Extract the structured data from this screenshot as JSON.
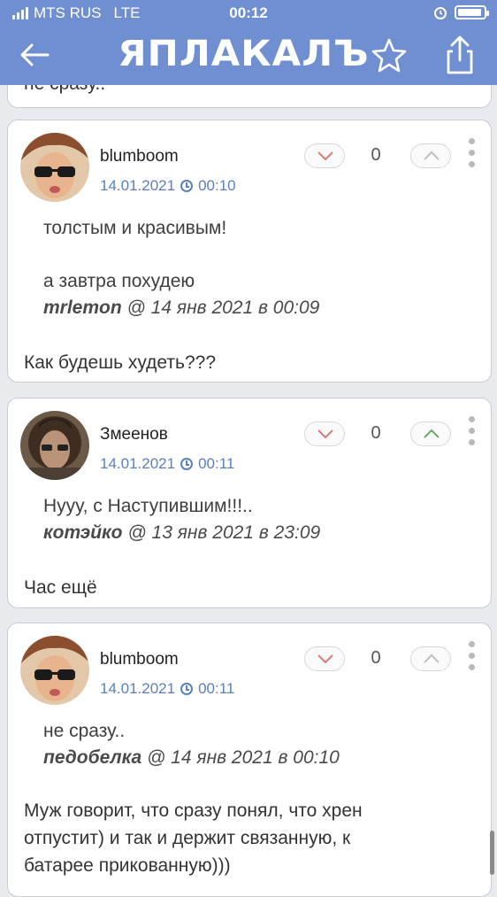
{
  "status_bar": {
    "carrier": "MTS RUS",
    "network": "LTE",
    "time": "00:12"
  },
  "header": {
    "logo_text": "ЯПЛАКАЛЪ"
  },
  "top_fragment": {
    "text": "не сразу.."
  },
  "comments": [
    {
      "username": "blumboom",
      "date": "14.01.2021",
      "time": "00:10",
      "votes": "0",
      "quote_text_1": "толстым и красивым!",
      "quote_text_2": "а завтра похудею",
      "quote_author": "mrlemon",
      "quote_meta": "@ 14 янв 2021 в 00:09",
      "body": "Как будешь худеть???"
    },
    {
      "username": "Змеенов",
      "date": "14.01.2021",
      "time": "00:11",
      "votes": "0",
      "quote_text_1": "Нууу, с Наступившим!!!..",
      "quote_author": "котэйко",
      "quote_meta": "@ 13 янв 2021 в 23:09",
      "body": "Час ещё"
    },
    {
      "username": "blumboom",
      "date": "14.01.2021",
      "time": "00:11",
      "votes": "0",
      "quote_text_1": "не сразу..",
      "quote_author": "педобелка",
      "quote_meta": "@ 14 янв 2021 в 00:10",
      "body_lines": [
        "Муж говорит, что сразу понял, что хрен",
        "отпустит) и так и держит связанную, к",
        "батарее прикованную)))"
      ]
    }
  ],
  "colors": {
    "header": "#6f8fd0",
    "date_blue": "#5a80c2",
    "background": "#e9eaee"
  },
  "icons": [
    "back-arrow-icon",
    "star-icon",
    "share-icon",
    "downvote-icon",
    "upvote-icon",
    "more-icon",
    "clock-icon"
  ]
}
